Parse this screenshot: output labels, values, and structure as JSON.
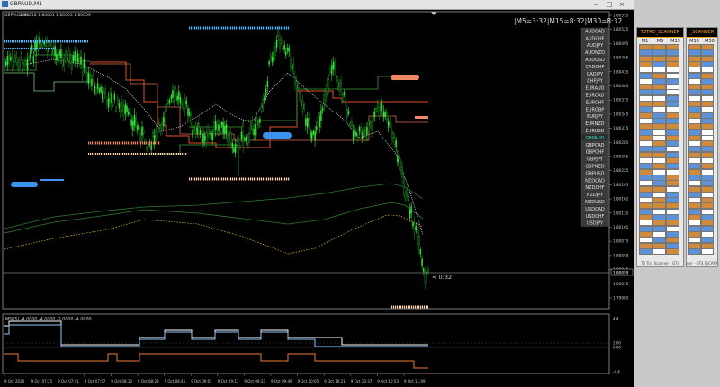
{
  "window": {
    "title": "GBPAUD,M1",
    "ohlc": "1.80018 1.80061 1.80003 1.80059"
  },
  "timers": {
    "text": "|M5=3:32|M15=8:32|M30=8:32"
  },
  "countdown": "< 0:32",
  "pairs": [
    {
      "label": "AUDCAD",
      "active": false
    },
    {
      "label": "AUDCHF",
      "active": false
    },
    {
      "label": "AUDJPY",
      "active": false
    },
    {
      "label": "AUDNZD",
      "active": false
    },
    {
      "label": "AUDUSD",
      "active": false
    },
    {
      "label": "CADCHF",
      "active": false
    },
    {
      "label": "CADJPY",
      "active": false
    },
    {
      "label": "CHFJPY",
      "active": false
    },
    {
      "label": "EURAUD",
      "active": false
    },
    {
      "label": "EURCAD",
      "active": false
    },
    {
      "label": "EURCHF",
      "active": false
    },
    {
      "label": "EURGBP",
      "active": false
    },
    {
      "label": "EURJPY",
      "active": false
    },
    {
      "label": "EURNZD",
      "active": false
    },
    {
      "label": "EURUSD",
      "active": false
    },
    {
      "label": "GBPAUD",
      "active": true
    },
    {
      "label": "GBPCAD",
      "active": false
    },
    {
      "label": "GBPCHF",
      "active": false
    },
    {
      "label": "GBPJPY",
      "active": false
    },
    {
      "label": "GBPNZD",
      "active": false
    },
    {
      "label": "GBPUSD",
      "active": false
    },
    {
      "label": "NZDCAD",
      "active": false
    },
    {
      "label": "NZDCHF",
      "active": false
    },
    {
      "label": "NZDJPY",
      "active": false
    },
    {
      "label": "NZDUSD",
      "active": false
    },
    {
      "label": "USDCAD",
      "active": false
    },
    {
      "label": "USDCHF",
      "active": false
    },
    {
      "label": "USDJPY",
      "active": false
    }
  ],
  "price_axis": [
    "1.80555",
    "1.80525",
    "1.80495",
    "1.80465",
    "1.80435",
    "1.80405",
    "1.80375",
    "1.80345",
    "1.80315",
    "1.80285",
    "1.80255",
    "1.80225",
    "1.80195",
    "1.80162",
    "1.80135",
    "1.80105",
    "1.80075",
    "1.80059",
    "1.80045",
    "1.80015",
    "1.79985"
  ],
  "current_price": "1.80059",
  "time_axis": [
    "9 Oct 2020",
    "9 Oct 07:25",
    "9 Oct 07:41",
    "9 Oct 07:57",
    "9 Oct 08:13",
    "9 Oct 08:29",
    "9 Oct 08:45",
    "9 Oct 09:01",
    "9 Oct 09:17",
    "9 Oct 09:33",
    "9 Oct 09:49",
    "9 Oct 10:05",
    "9 Oct 10:21",
    "9 Oct 10:37",
    "9 Oct 10:53",
    "9 Oct 11:09"
  ],
  "indicator": {
    "label": "MSI(5) -4.0000 -4.0000 -2.0000 -4.0000",
    "axis": [
      "4.4",
      "2.00",
      "0.00",
      "-4.4"
    ]
  },
  "scanner1": {
    "title": "T3TRO_SCANNER",
    "headers": [
      "M1",
      "M5",
      "M15"
    ],
    "footer": "T3 Trix Scanner - GT4"
  },
  "scanner2": {
    "title": "_SCANNER",
    "headers": [
      "M15",
      "M30"
    ],
    "footer": "ner - GT4 [SCANR#4"
  },
  "colors": {
    "bull_candle": "#35e33a",
    "panel_orange": "#d08a3b",
    "panel_blue": "#5b92d8",
    "panel_white": "#ffffff",
    "accent_orange": "#f1a324"
  }
}
